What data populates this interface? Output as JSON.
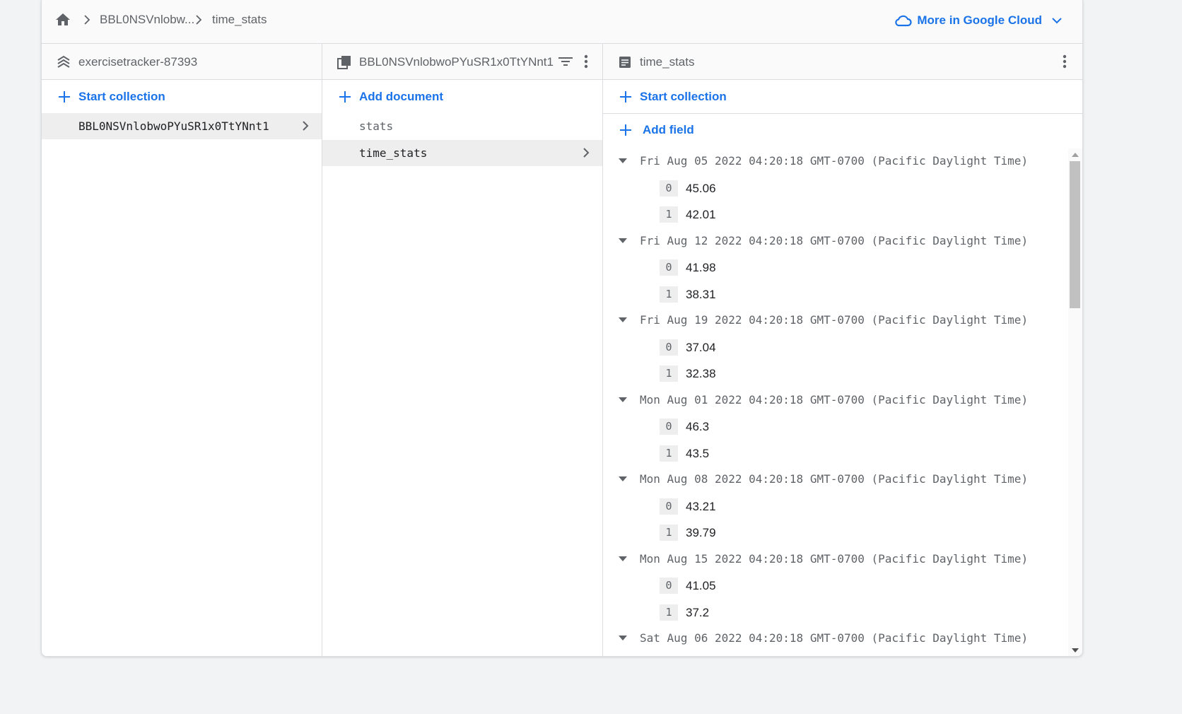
{
  "breadcrumb": {
    "items": [
      "BBL0NSVnlobw...",
      "time_stats"
    ]
  },
  "cloud_link": {
    "label": "More in Google Cloud"
  },
  "panels": {
    "root": {
      "title": "exercisetracker-87393",
      "action": "Start collection",
      "items": [
        {
          "label": "BBL0NSVnlobwoPYuSR1x0TtYNnt1"
        }
      ]
    },
    "collection": {
      "title": "BBL0NSVnlobwoPYuSR1x0TtYNnt1",
      "action": "Add document",
      "items": [
        {
          "label": "stats"
        },
        {
          "label": "time_stats"
        }
      ]
    },
    "document": {
      "title": "time_stats",
      "action_collection": "Start collection",
      "action_field": "Add field",
      "fields": [
        {
          "key": "Fri Aug 05 2022 04:20:18 GMT-0700 (Pacific Daylight Time)",
          "values": [
            {
              "index": "0",
              "value": "45.06"
            },
            {
              "index": "1",
              "value": "42.01"
            }
          ]
        },
        {
          "key": "Fri Aug 12 2022 04:20:18 GMT-0700 (Pacific Daylight Time)",
          "values": [
            {
              "index": "0",
              "value": "41.98"
            },
            {
              "index": "1",
              "value": "38.31"
            }
          ]
        },
        {
          "key": "Fri Aug 19 2022 04:20:18 GMT-0700 (Pacific Daylight Time)",
          "values": [
            {
              "index": "0",
              "value": "37.04"
            },
            {
              "index": "1",
              "value": "32.38"
            }
          ]
        },
        {
          "key": "Mon Aug 01 2022 04:20:18 GMT-0700 (Pacific Daylight Time)",
          "values": [
            {
              "index": "0",
              "value": "46.3"
            },
            {
              "index": "1",
              "value": "43.5"
            }
          ]
        },
        {
          "key": "Mon Aug 08 2022 04:20:18 GMT-0700 (Pacific Daylight Time)",
          "values": [
            {
              "index": "0",
              "value": "43.21"
            },
            {
              "index": "1",
              "value": "39.79"
            }
          ]
        },
        {
          "key": "Mon Aug 15 2022 04:20:18 GMT-0700 (Pacific Daylight Time)",
          "values": [
            {
              "index": "0",
              "value": "41.05"
            },
            {
              "index": "1",
              "value": "37.2"
            }
          ]
        },
        {
          "key": "Sat Aug 06 2022 04:20:18 GMT-0700 (Pacific Daylight Time)",
          "values": []
        }
      ]
    }
  },
  "colors": {
    "accent": "#1a73e8",
    "text_muted": "#5f6368",
    "selected_row": "#eeeeee",
    "border": "#dadce0"
  }
}
